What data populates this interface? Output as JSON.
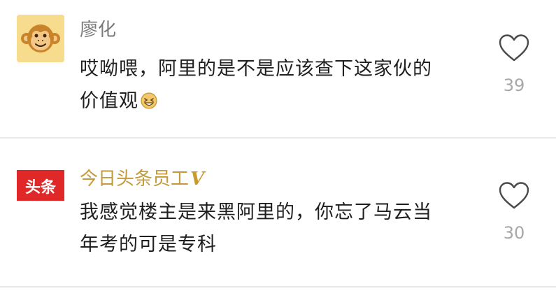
{
  "comments": [
    {
      "username": "廖化",
      "avatar_icon": "monkey-face-icon",
      "text_line1": "哎呦喂，阿里的是不是应该查下这家伙的",
      "text_line2": "价值观",
      "trailing_emoji": "laughing-emoji-icon",
      "likes": "39"
    },
    {
      "username": "今日头条员工",
      "verified_mark": "V",
      "avatar_icon": "toutiao-logo-icon",
      "avatar_text": "头条",
      "text_line1": "我感觉楼主是来黑阿里的，你忘了马云当",
      "text_line2": "年考的可是专科",
      "likes": "30"
    }
  ],
  "colors": {
    "username_default": "#7a7a7a",
    "username_staff": "#c49a3a",
    "like_count": "#a8a8a8",
    "toutiao_red": "#e02828",
    "avatar_yellow": "#f6dc8c"
  }
}
